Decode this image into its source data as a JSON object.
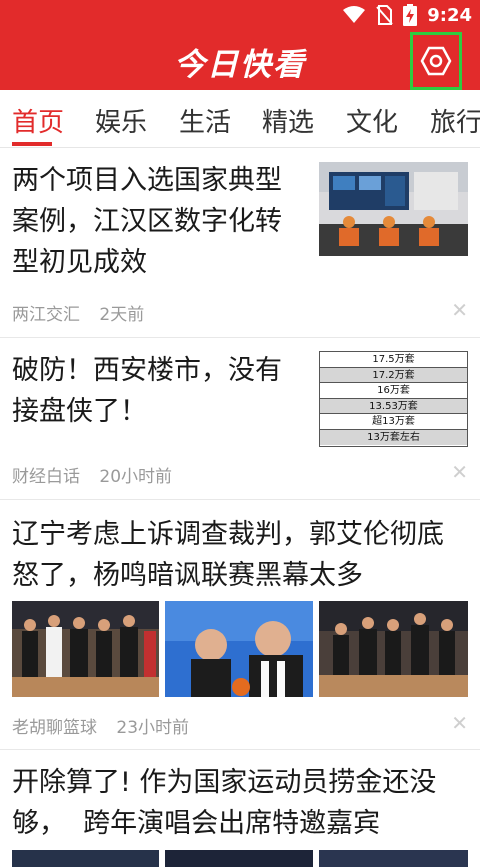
{
  "status_bar": {
    "time": "9:24",
    "icons": [
      "wifi-icon",
      "no-sim-icon",
      "battery-charging-icon"
    ]
  },
  "header": {
    "title": "今日快看",
    "settings_icon": "gear-hexagon-icon"
  },
  "tabs": [
    {
      "label": "首页",
      "active": true
    },
    {
      "label": "娱乐",
      "active": false
    },
    {
      "label": "生活",
      "active": false
    },
    {
      "label": "精选",
      "active": false
    },
    {
      "label": "文化",
      "active": false
    },
    {
      "label": "旅行",
      "active": false
    }
  ],
  "articles": [
    {
      "title_lines": [
        "两个项目入选国家典型",
        "案例，江汉区数字化转",
        "型初见成效"
      ],
      "source": "两江交汇",
      "time": "2天前"
    },
    {
      "title_lines": [
        "破防！西安楼市，没有",
        "接盘侠了！"
      ],
      "source": "财经白话",
      "time": "20小时前",
      "thumb_table": [
        "17.5万套",
        "17.2万套",
        "16万套",
        "13.53万套",
        "超13万套",
        "13万套左右"
      ]
    },
    {
      "title_lines": [
        "辽宁考虑上诉调查裁判，郭艾伦彻底",
        "怒了，杨鸣暗讽联赛黑幕太多"
      ],
      "source": "老胡聊篮球",
      "time": "23小时前"
    },
    {
      "title_lines": [
        "开除算了! 作为国家运动员捞金还没",
        "够，  跨年演唱会出席特邀嘉宾"
      ]
    }
  ],
  "colors": {
    "brand_red": "#e22b2b",
    "highlight_green": "#2ecc40",
    "meta_gray": "#9a9a9a"
  }
}
